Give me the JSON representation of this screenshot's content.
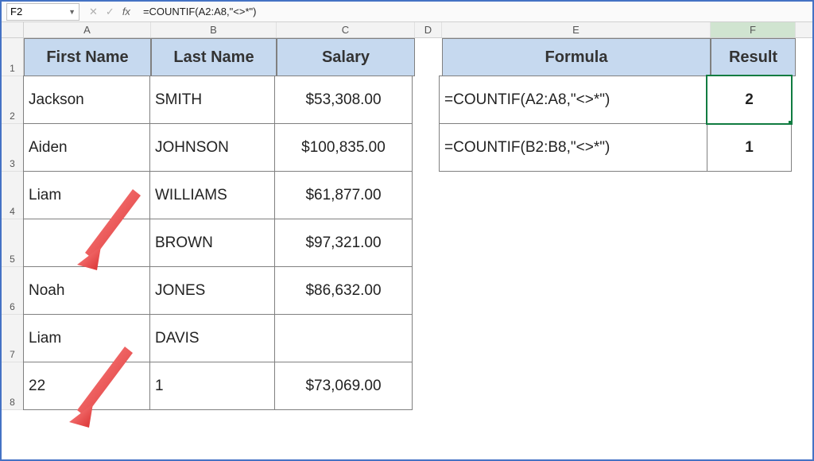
{
  "formula_bar": {
    "name_box": "F2",
    "cancel_icon": "✕",
    "confirm_icon": "✓",
    "fx_label": "fx",
    "formula_text": "=COUNTIF(A2:A8,\"<>*\")"
  },
  "columns": [
    "A",
    "B",
    "C",
    "D",
    "E",
    "F"
  ],
  "row_numbers": [
    "1",
    "2",
    "3",
    "4",
    "5",
    "6",
    "7",
    "8"
  ],
  "headers_left": {
    "a": "First Name",
    "b": "Last Name",
    "c": "Salary"
  },
  "headers_right": {
    "e": "Formula",
    "f": "Result"
  },
  "data": [
    {
      "a": "Jackson",
      "b": "SMITH",
      "c": "$53,308.00",
      "e": "=COUNTIF(A2:A8,\"<>*\")",
      "f": "2"
    },
    {
      "a": "Aiden",
      "b": "JOHNSON",
      "c": "$100,835.00",
      "e": "=COUNTIF(B2:B8,\"<>*\")",
      "f": "1"
    },
    {
      "a": "Liam",
      "b": "WILLIAMS",
      "c": "$61,877.00"
    },
    {
      "a": "",
      "b": "BROWN",
      "c": "$97,321.00"
    },
    {
      "a": "Noah",
      "b": "JONES",
      "c": "$86,632.00"
    },
    {
      "a": "Liam",
      "b": "DAVIS",
      "c": ""
    },
    {
      "a": "22",
      "b": "1",
      "c": "$73,069.00"
    }
  ]
}
